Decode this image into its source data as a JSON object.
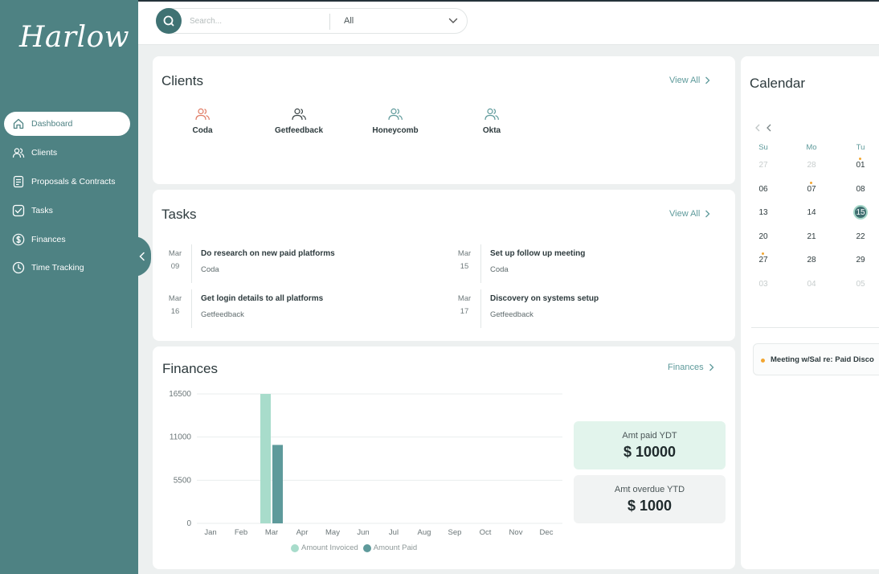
{
  "app": {
    "logo": "Harlow"
  },
  "sidebar": {
    "items": [
      {
        "label": "Dashboard",
        "icon": "home-icon",
        "active": true
      },
      {
        "label": "Clients",
        "icon": "users-icon",
        "active": false
      },
      {
        "label": "Proposals & Contracts",
        "icon": "document-icon",
        "active": false
      },
      {
        "label": "Tasks",
        "icon": "checkbox-icon",
        "active": false
      },
      {
        "label": "Finances",
        "icon": "dollar-icon",
        "active": false
      },
      {
        "label": "Time Tracking",
        "icon": "clock-icon",
        "active": false
      }
    ]
  },
  "search": {
    "placeholder": "Search...",
    "value": "",
    "filter_selected": "All"
  },
  "clients": {
    "title": "Clients",
    "view_all": "View All",
    "items": [
      {
        "name": "Coda",
        "icon_color": "#e07a63"
      },
      {
        "name": "Getfeedback",
        "icon_color": "#3b4547"
      },
      {
        "name": "Honeycomb",
        "icon_color": "#5e9a9b"
      },
      {
        "name": "Okta",
        "icon_color": "#5e9a9b"
      }
    ]
  },
  "tasks": {
    "title": "Tasks",
    "view_all": "View All",
    "items": [
      {
        "month": "Mar",
        "day": "09",
        "title": "Do research on new paid platforms",
        "client": "Coda"
      },
      {
        "month": "Mar",
        "day": "15",
        "title": "Set up follow up meeting",
        "client": "Coda"
      },
      {
        "month": "Mar",
        "day": "16",
        "title": "Get login details to all platforms",
        "client": "Getfeedback"
      },
      {
        "month": "Mar",
        "day": "17",
        "title": "Discovery on systems setup",
        "client": "Getfeedback"
      }
    ]
  },
  "finances": {
    "title": "Finances",
    "link": "Finances",
    "paid_label": "Amt paid YDT",
    "paid_value": "$ 10000",
    "overdue_label": "Amt overdue YTD",
    "overdue_value": "$ 1000"
  },
  "chart_data": {
    "type": "bar",
    "categories": [
      "Jan",
      "Feb",
      "Mar",
      "Apr",
      "May",
      "Jun",
      "Jul",
      "Aug",
      "Sep",
      "Oct",
      "Nov",
      "Dec"
    ],
    "series": [
      {
        "name": "Amount Invoiced",
        "color": "#a8dccb",
        "values": [
          0,
          0,
          16500,
          0,
          0,
          0,
          0,
          0,
          0,
          0,
          0,
          0
        ]
      },
      {
        "name": "Amount Paid",
        "color": "#5e9a9b",
        "values": [
          0,
          0,
          10000,
          0,
          0,
          0,
          0,
          0,
          0,
          0,
          0,
          0
        ]
      }
    ],
    "yticks": [
      0,
      5500,
      11000,
      16500
    ],
    "ylim": [
      0,
      16500
    ],
    "grid": true,
    "legend": "bottom"
  },
  "calendar": {
    "title": "Calendar",
    "weekdays": [
      "Su",
      "Mo",
      "Tu"
    ],
    "rows": [
      [
        {
          "d": "27",
          "muted": true
        },
        {
          "d": "28",
          "muted": true
        },
        {
          "d": "01",
          "dot": true
        }
      ],
      [
        {
          "d": "06"
        },
        {
          "d": "07",
          "dot": true
        },
        {
          "d": "08"
        }
      ],
      [
        {
          "d": "13"
        },
        {
          "d": "14"
        },
        {
          "d": "15",
          "today": true
        }
      ],
      [
        {
          "d": "20"
        },
        {
          "d": "21"
        },
        {
          "d": "22"
        }
      ],
      [
        {
          "d": "27",
          "dot": true
        },
        {
          "d": "28"
        },
        {
          "d": "29"
        }
      ],
      [
        {
          "d": "03",
          "muted": true
        },
        {
          "d": "04",
          "muted": true
        },
        {
          "d": "05",
          "muted": true
        }
      ]
    ],
    "event": "Meeting w/Sal re: Paid Disco"
  }
}
